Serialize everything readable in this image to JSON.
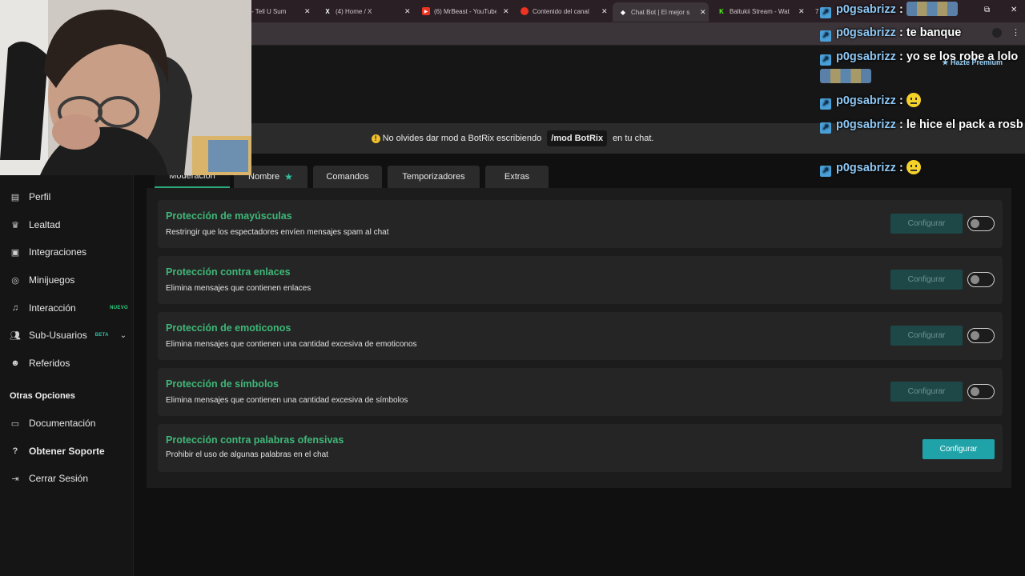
{
  "browser": {
    "tabs": [
      {
        "title": "- Tell U Sum"
      },
      {
        "title": "(4) Home / X"
      },
      {
        "title": "(6) MrBeast - YouTube"
      },
      {
        "title": "Contenido del canal"
      },
      {
        "title": "Chat Bot | El mejor s"
      },
      {
        "title": "Baltukii Stream - Wat"
      },
      {
        "title": "7"
      }
    ],
    "restore_glyph": "⧉",
    "close_glyph": "✕"
  },
  "notice": {
    "text_before": "No olvides dar mod a BotRix escribiendo",
    "command": "/mod BotRix",
    "text_after": "en tu chat."
  },
  "sidebar": {
    "items": [
      {
        "label": "Perfil",
        "icon": "id-card-icon"
      },
      {
        "label": "Lealtad",
        "icon": "trophy-icon"
      },
      {
        "label": "Integraciones",
        "icon": "discord-icon"
      },
      {
        "label": "Minijuegos",
        "icon": "gamepad-icon"
      },
      {
        "label": "Interacción",
        "icon": "music-note-icon",
        "badge": "NUEVO",
        "badge_color": "#2fd07f"
      },
      {
        "label": "Sub-Usuarios",
        "icon": "users-icon",
        "badge": "BETA",
        "badge_color": "#2fc2a2"
      },
      {
        "label": "Referidos",
        "icon": "user-group-icon"
      }
    ],
    "section_title": "Otras Opciones",
    "other": [
      {
        "label": "Documentación",
        "icon": "document-icon"
      },
      {
        "label": "Obtener Soporte",
        "icon": "help-icon"
      },
      {
        "label": "Cerrar Sesión",
        "icon": "logout-icon"
      }
    ]
  },
  "content_tabs": [
    {
      "label": "Moderación",
      "active": true
    },
    {
      "label": "Nombre"
    },
    {
      "label": "Comandos"
    },
    {
      "label": "Temporizadores"
    },
    {
      "label": "Extras"
    }
  ],
  "protections": [
    {
      "title": "Protección de mayúsculas",
      "desc": "Restringir que los espectadores envíen mensajes spam al chat",
      "button": "Configurar",
      "enabled": false
    },
    {
      "title": "Protección contra enlaces",
      "desc": "Elimina mensajes que contienen enlaces",
      "button": "Configurar",
      "enabled": false
    },
    {
      "title": "Protección de emoticonos",
      "desc": "Elimina mensajes que contienen una cantidad excesiva de emoticonos",
      "button": "Configurar",
      "enabled": false
    },
    {
      "title": "Protección de símbolos",
      "desc": "Elimina mensajes que contienen una cantidad excesiva de símbolos",
      "button": "Configurar",
      "enabled": false
    },
    {
      "title": "Protección contra palabras ofensivas",
      "desc": "Prohibir el uso de algunas palabras en el chat",
      "button": "Configurar"
    }
  ],
  "chat": {
    "premium_label": "Hazte Premium",
    "messages": [
      {
        "user": "p0gsabrizz",
        "text": "",
        "emote": "image"
      },
      {
        "user": "p0gsabrizz",
        "text": "te banque"
      },
      {
        "user": "p0gsabrizz",
        "text": "yo se los robe a lolo",
        "emote": "image"
      },
      {
        "user": "p0gsabrizz",
        "text": "",
        "emote": "neutral-face"
      },
      {
        "user": "p0gsabrizz",
        "text": "le hice el pack a rosb"
      },
      {
        "user": "p0gsabrizz",
        "text": "",
        "emote": "neutral-face"
      }
    ]
  }
}
